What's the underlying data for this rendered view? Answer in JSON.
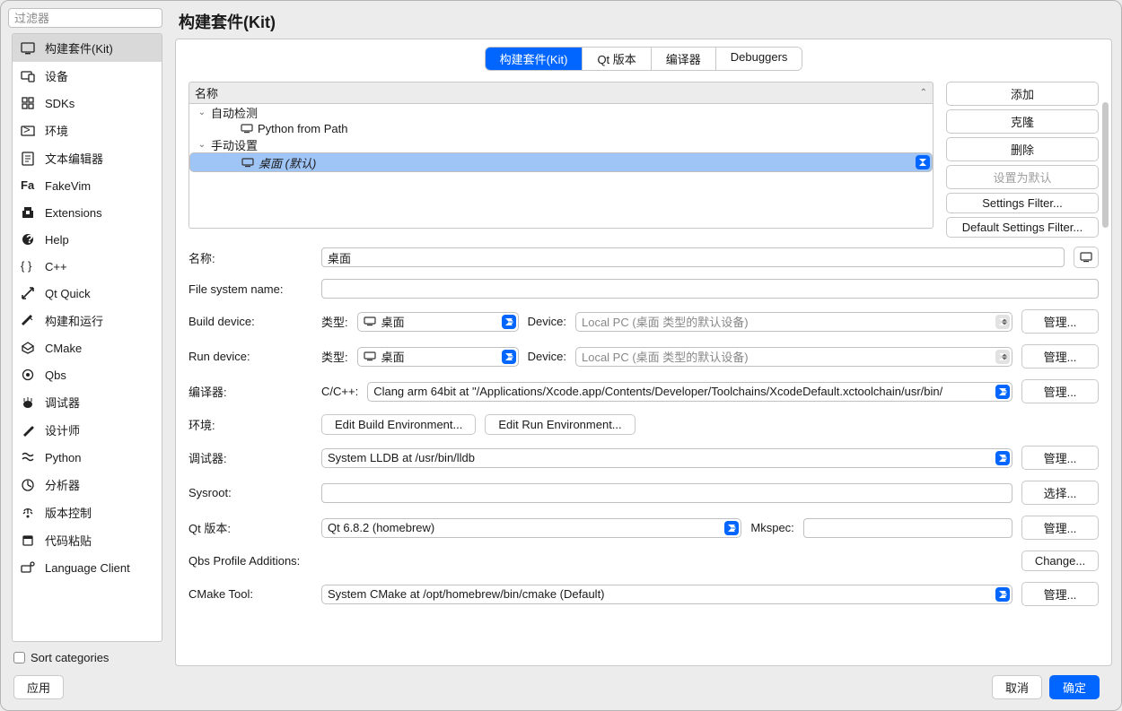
{
  "filter_placeholder": "过滤器",
  "page_title": "构建套件(Kit)",
  "categories": [
    {
      "label": "构建套件(Kit)",
      "selected": true
    },
    {
      "label": "设备"
    },
    {
      "label": "SDKs"
    },
    {
      "label": "环境"
    },
    {
      "label": "文本编辑器"
    },
    {
      "label": "FakeVim"
    },
    {
      "label": "Extensions"
    },
    {
      "label": "Help"
    },
    {
      "label": "C++"
    },
    {
      "label": "Qt Quick"
    },
    {
      "label": "构建和运行"
    },
    {
      "label": "CMake"
    },
    {
      "label": "Qbs"
    },
    {
      "label": "调试器"
    },
    {
      "label": "设计师"
    },
    {
      "label": "Python"
    },
    {
      "label": "分析器"
    },
    {
      "label": "版本控制"
    },
    {
      "label": "代码粘贴"
    },
    {
      "label": "Language Client"
    }
  ],
  "sort_label": "Sort categories",
  "apply_label": "应用",
  "tabs": [
    {
      "label": "构建套件(Kit)",
      "active": true
    },
    {
      "label": "Qt 版本"
    },
    {
      "label": "编译器"
    },
    {
      "label": "Debuggers"
    }
  ],
  "tree": {
    "header": "名称",
    "rows": [
      {
        "kind": "group",
        "label": "自动检测",
        "expanded": true
      },
      {
        "kind": "item",
        "label": "Python from Path"
      },
      {
        "kind": "group",
        "label": "手动设置",
        "expanded": true
      },
      {
        "kind": "item",
        "label": "桌面 (默认)",
        "selected": true,
        "italic": true
      }
    ]
  },
  "side_buttons": {
    "add": "添加",
    "clone": "克隆",
    "delete": "删除",
    "make_default": "设置为默认",
    "settings_filter": "Settings Filter...",
    "default_settings_filter": "Default Settings Filter..."
  },
  "form": {
    "name_label": "名称:",
    "name_value": "桌面",
    "fs_label": "File system name:",
    "fs_value": "",
    "build_device_label": "Build device:",
    "run_device_label": "Run device:",
    "type_label": "类型:",
    "device_label": "Device:",
    "type_value": "桌面",
    "device_value": "Local PC (桌面 类型的默认设备)",
    "manage": "管理...",
    "compiler_label": "编译器:",
    "cpp_label": "C/C++:",
    "cpp_value": "Clang arm 64bit at \"/Applications/Xcode.app/Contents/Developer/Toolchains/XcodeDefault.xctoolchain/usr/bin/",
    "env_label": "环境:",
    "edit_build_env": "Edit Build Environment...",
    "edit_run_env": "Edit Run Environment...",
    "debugger_label": "调试器:",
    "debugger_value": "System LLDB at /usr/bin/lldb",
    "sysroot_label": "Sysroot:",
    "sysroot_value": "",
    "choose": "选择...",
    "qt_label": "Qt 版本:",
    "qt_value": "Qt 6.8.2 (homebrew)",
    "mkspec_label": "Mkspec:",
    "mkspec_value": "",
    "qbs_label": "Qbs Profile Additions:",
    "change": "Change...",
    "cmake_label": "CMake Tool:",
    "cmake_value": "System CMake at /opt/homebrew/bin/cmake (Default)"
  },
  "footer": {
    "cancel": "取消",
    "ok": "确定"
  }
}
